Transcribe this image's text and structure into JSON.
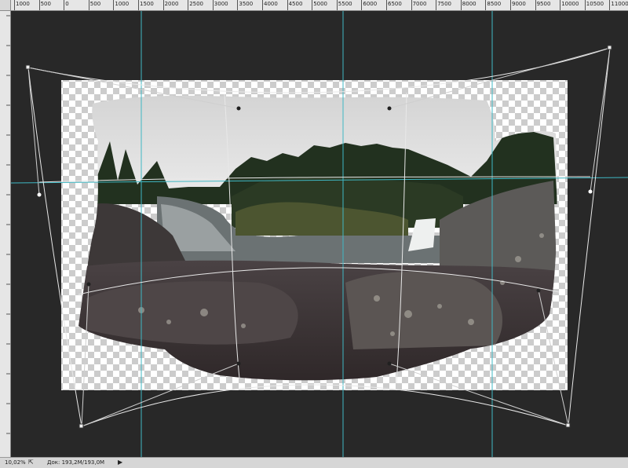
{
  "ruler": {
    "horizontal_labels": [
      "1000",
      "500",
      "0",
      "500",
      "1000",
      "1500",
      "2000",
      "2500",
      "3000",
      "3500",
      "4000",
      "4500",
      "5000",
      "5500",
      "6000",
      "6500",
      "7000",
      "7500",
      "8000",
      "8500",
      "9000",
      "9500",
      "10000",
      "10500",
      "11000"
    ]
  },
  "status": {
    "zoom": "10,02%",
    "doc_label": "Док: 193,2M/193,0M",
    "arrow": "▶"
  },
  "colors": {
    "guide": "#3fb8c4",
    "workspace": "#282828",
    "ruler": "#e6e6e6",
    "warp_line": "#e8e8e8"
  }
}
